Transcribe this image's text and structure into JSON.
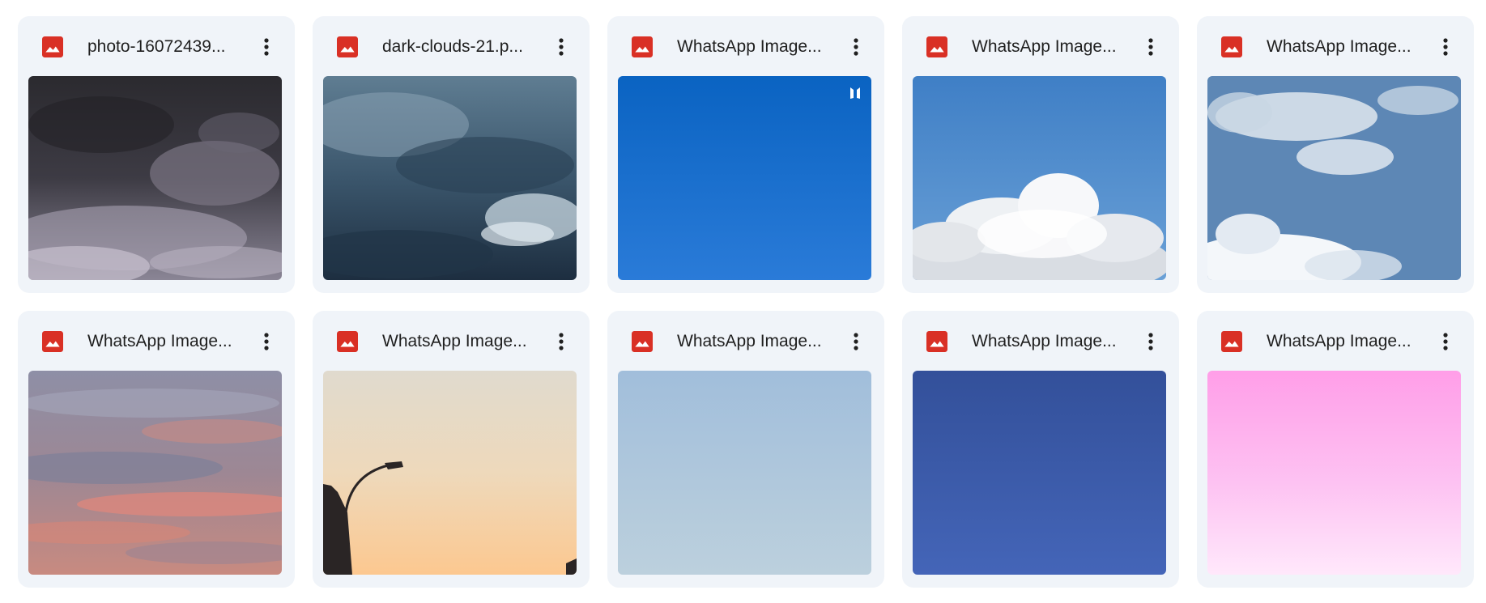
{
  "files": [
    {
      "name": "photo-16072439...",
      "icon": "image-file-icon",
      "thumbnail": "dark-storm-clouds"
    },
    {
      "name": "dark-clouds-21.p...",
      "icon": "image-file-icon",
      "thumbnail": "blue-storm-clouds"
    },
    {
      "name": "WhatsApp Image...",
      "icon": "image-file-icon",
      "thumbnail": "clear-blue-sky"
    },
    {
      "name": "WhatsApp Image...",
      "icon": "image-file-icon",
      "thumbnail": "sky-with-cumulus"
    },
    {
      "name": "WhatsApp Image...",
      "icon": "image-file-icon",
      "thumbnail": "sky-with-wispy-clouds"
    },
    {
      "name": "WhatsApp Image...",
      "icon": "image-file-icon",
      "thumbnail": "sunset-pink-clouds"
    },
    {
      "name": "WhatsApp Image...",
      "icon": "image-file-icon",
      "thumbnail": "dusk-with-streetlamp"
    },
    {
      "name": "WhatsApp Image...",
      "icon": "image-file-icon",
      "thumbnail": "pale-blue-sky"
    },
    {
      "name": "WhatsApp Image...",
      "icon": "image-file-icon",
      "thumbnail": "deep-blue-sky"
    },
    {
      "name": "WhatsApp Image...",
      "icon": "image-file-icon",
      "thumbnail": "pink-gradient-sky"
    }
  ],
  "more_icon": "more-vert-icon",
  "colors": {
    "card_background": "#f0f4f9",
    "file_icon_red": "#d93025",
    "text": "#1f1f1f"
  }
}
